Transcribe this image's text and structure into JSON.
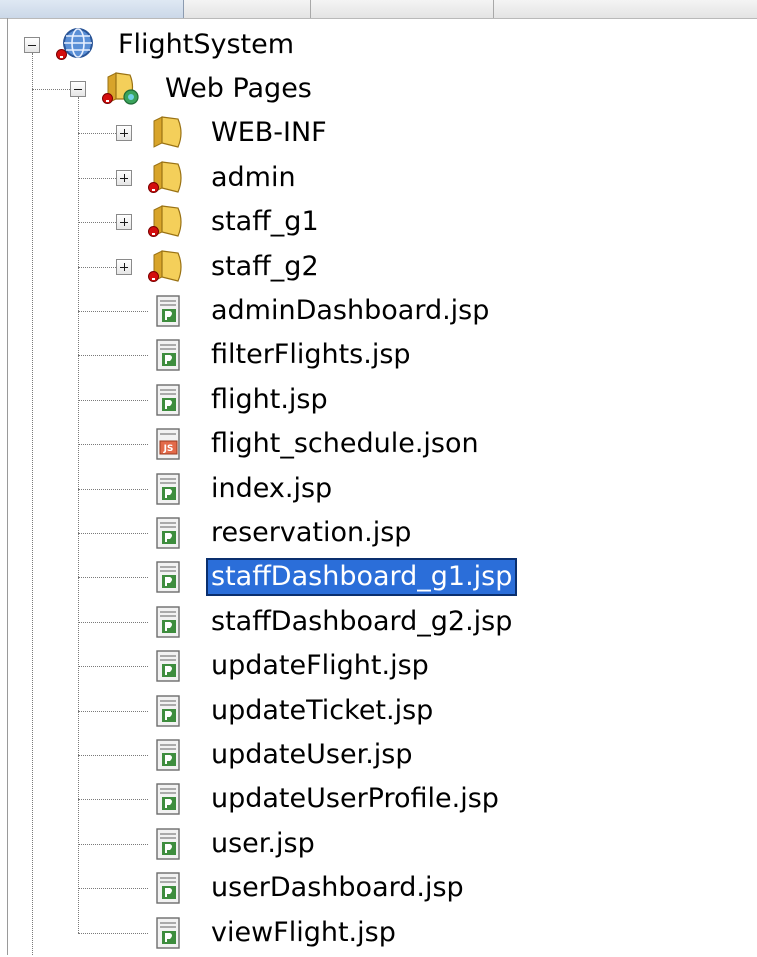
{
  "project": {
    "name": "FlightSystem",
    "icon": "globe-project-icon"
  },
  "web_pages": {
    "label": "Web Pages",
    "icon": "web-pages-folder-icon"
  },
  "folders": [
    {
      "label": "WEB-INF",
      "icon": "folder-icon"
    },
    {
      "label": "admin",
      "icon": "folder-error-icon"
    },
    {
      "label": "staff_g1",
      "icon": "folder-error-icon"
    },
    {
      "label": "staff_g2",
      "icon": "folder-error-icon"
    }
  ],
  "files": [
    {
      "label": "adminDashboard.jsp",
      "icon": "jsp-file-icon"
    },
    {
      "label": "filterFlights.jsp",
      "icon": "jsp-file-icon"
    },
    {
      "label": "flight.jsp",
      "icon": "jsp-file-icon"
    },
    {
      "label": "flight_schedule.json",
      "icon": "json-file-icon"
    },
    {
      "label": "index.jsp",
      "icon": "jsp-file-icon"
    },
    {
      "label": "reservation.jsp",
      "icon": "jsp-file-icon"
    },
    {
      "label": "staffDashboard_g1.jsp",
      "icon": "jsp-file-icon",
      "selected": true
    },
    {
      "label": "staffDashboard_g2.jsp",
      "icon": "jsp-file-icon"
    },
    {
      "label": "updateFlight.jsp",
      "icon": "jsp-file-icon"
    },
    {
      "label": "updateTicket.jsp",
      "icon": "jsp-file-icon"
    },
    {
      "label": "updateUser.jsp",
      "icon": "jsp-file-icon"
    },
    {
      "label": "updateUserProfile.jsp",
      "icon": "jsp-file-icon"
    },
    {
      "label": "user.jsp",
      "icon": "jsp-file-icon"
    },
    {
      "label": "userDashboard.jsp",
      "icon": "jsp-file-icon"
    },
    {
      "label": "viewFlight.jsp",
      "icon": "jsp-file-icon"
    }
  ],
  "colors": {
    "selection": "#2b6ed9",
    "error_badge": "#d40e0e",
    "folder": "#f0c040"
  }
}
